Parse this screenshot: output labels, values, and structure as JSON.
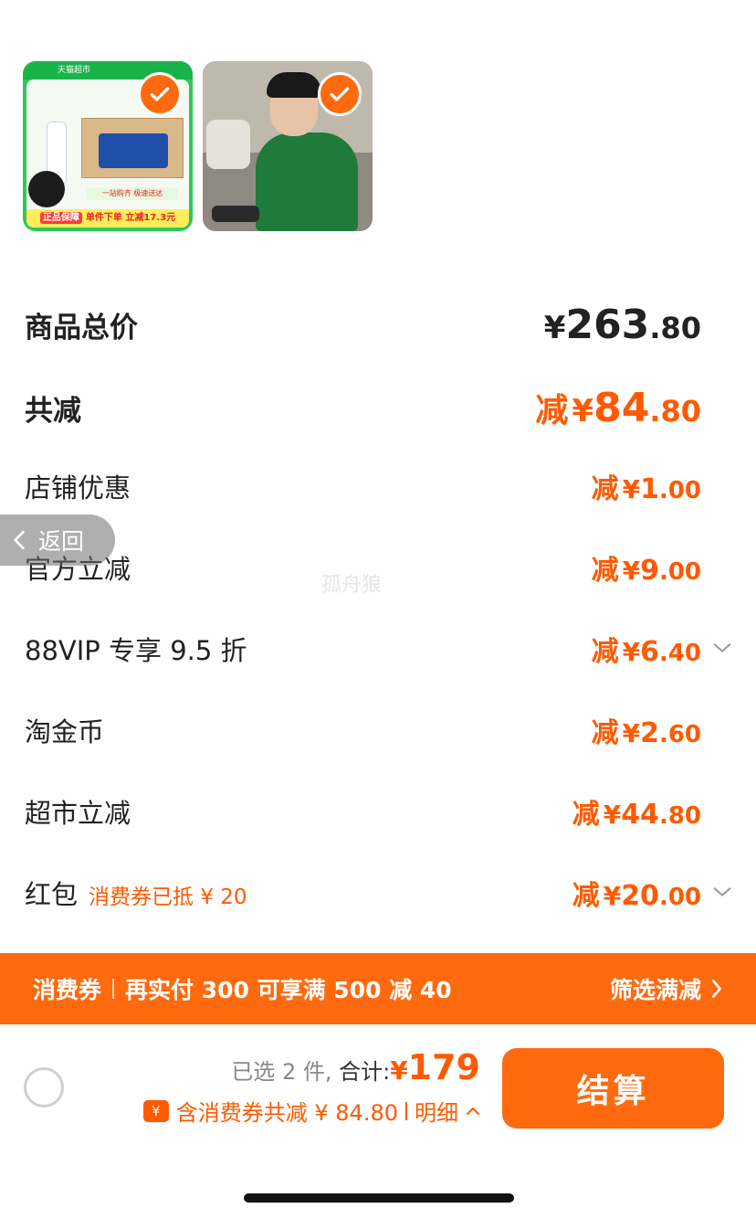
{
  "products": [
    {
      "name": "product-1",
      "banner": "天猫超市",
      "bottom_tag": "正品保障",
      "bottom_text": "单件下单 立减17.3元",
      "line": "一站购齐 极速送达",
      "selected": true
    },
    {
      "name": "product-2",
      "selected": true
    }
  ],
  "price_rows": {
    "total": {
      "label": "商品总价",
      "currency": "¥",
      "int": "263",
      "dec": ".80"
    },
    "reduce": {
      "label": "共减",
      "prefix": "减",
      "currency": "¥",
      "int": "84",
      "dec": ".80"
    },
    "items": [
      {
        "label": "店铺优惠",
        "prefix": "减",
        "currency": "¥",
        "int": "1",
        "dec": ".00"
      },
      {
        "label": "官方立减",
        "prefix": "减",
        "currency": "¥",
        "int": "9",
        "dec": ".00"
      },
      {
        "label": "88VIP 专享 9.5 折",
        "prefix": "减",
        "currency": "¥",
        "int": "6",
        "dec": ".40",
        "expand": true
      },
      {
        "label": "淘金币",
        "prefix": "减",
        "currency": "¥",
        "int": "2",
        "dec": ".60"
      },
      {
        "label": "超市立减",
        "prefix": "减",
        "currency": "¥",
        "int": "44",
        "dec": ".80"
      },
      {
        "label": "红包",
        "note": "消费券已抵 ¥ 20",
        "prefix": "减",
        "currency": "¥",
        "int": "20",
        "dec": ".00",
        "expand": true
      }
    ]
  },
  "watermark": "孤舟狼",
  "back": {
    "label": "返回"
  },
  "coupon_bar": {
    "tag": "消费券",
    "message": "再实付 300 可享满 500 减 40",
    "filter": "筛选满减"
  },
  "checkout_bar": {
    "selected_text": "已选 2 件,",
    "total_label": " 合计:",
    "currency": "¥",
    "total": "179",
    "badge": "¥",
    "discount_text": "含消费券共减 ¥ 84.80",
    "detail": "明细",
    "button": "结算"
  },
  "colors": {
    "accent": "#ff6a0e",
    "price_red": "#ff5a00"
  }
}
